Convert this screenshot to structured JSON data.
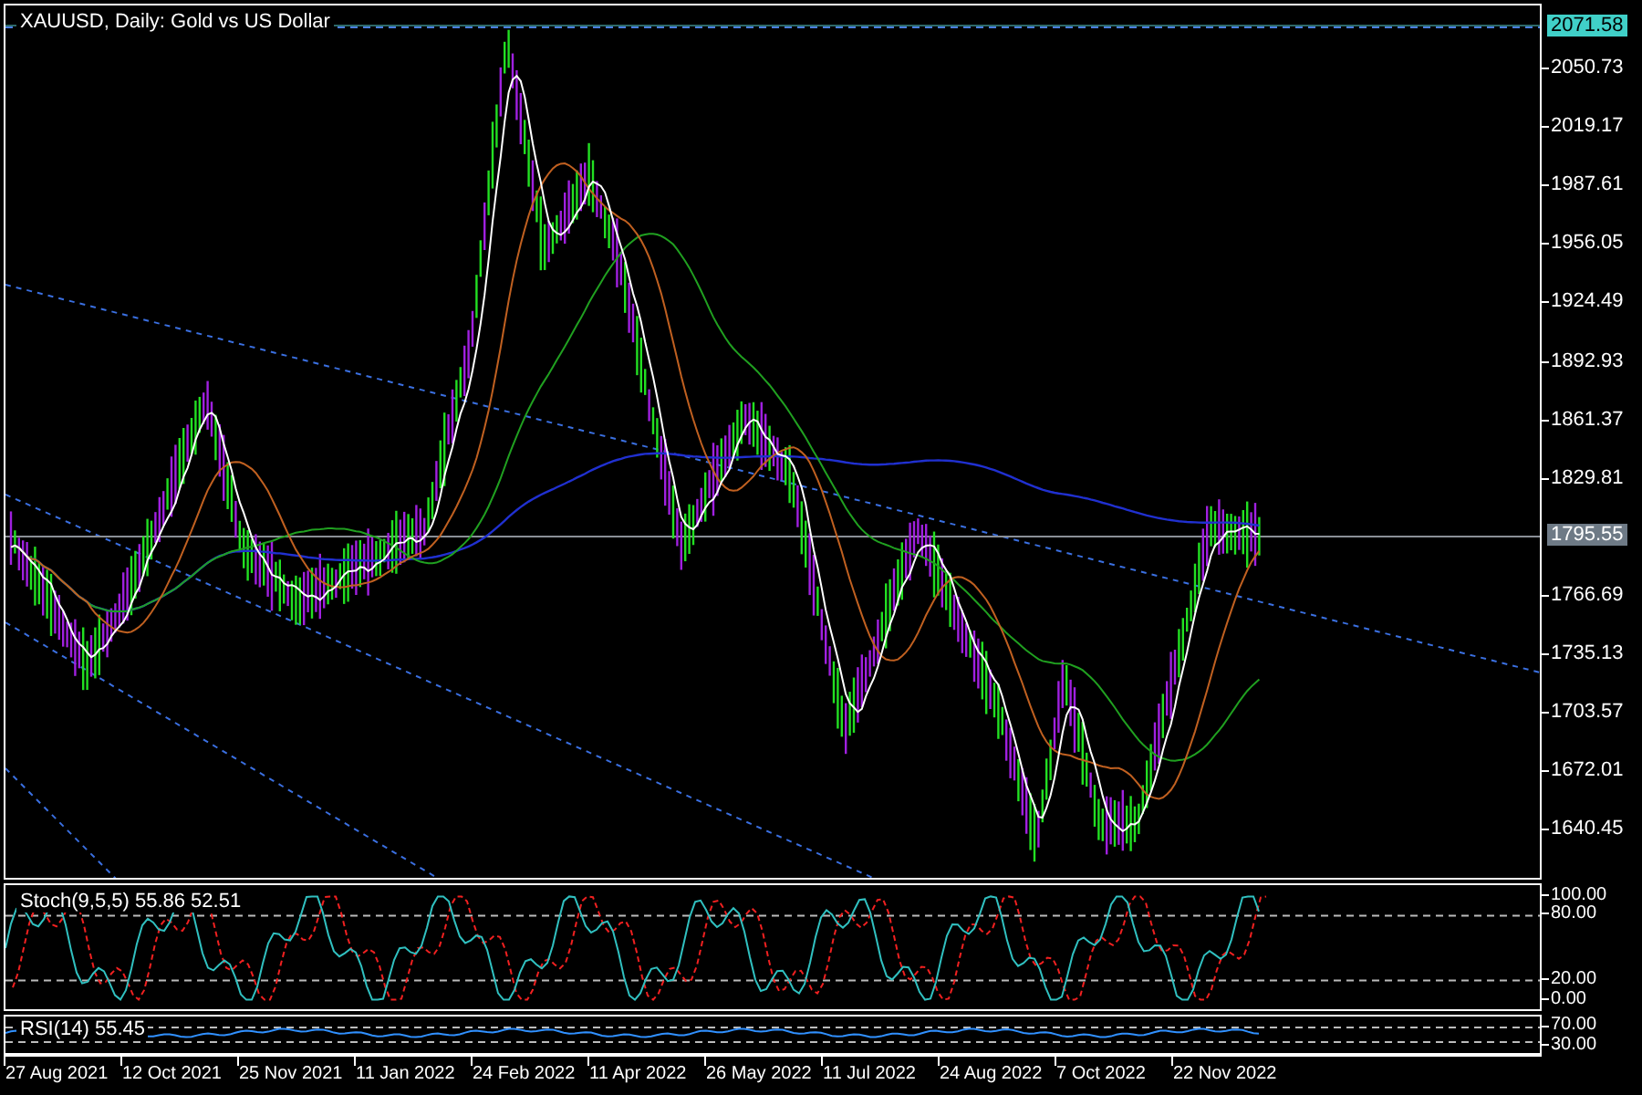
{
  "chart": {
    "title": "XAUUSD, Daily: Gold vs US Dollar",
    "high_marker": "2071.58",
    "last_price": "1795.55"
  },
  "price_axis": {
    "labels": [
      "2050.73",
      "2019.17",
      "1987.61",
      "1956.05",
      "1924.49",
      "1892.93",
      "1861.37",
      "1829.81",
      "1766.69",
      "1735.13",
      "1703.57",
      "1672.01",
      "1640.45"
    ]
  },
  "stochastic": {
    "label": "Stoch(9,5,5) 55.86 52.51",
    "axis_labels": [
      "100.00",
      "80.00",
      "20.00",
      "0.00"
    ]
  },
  "rsi": {
    "label": "RSI(14) 55.45",
    "axis_labels": [
      "70.00",
      "30.00"
    ]
  },
  "time_axis": {
    "labels": [
      "27 Aug 2021",
      "12 Oct 2021",
      "25 Nov 2021",
      "11 Jan 2022",
      "24 Feb 2022",
      "11 Apr 2022",
      "26 May 2022",
      "11 Jul 2022",
      "24 Aug 2022",
      "7 Oct 2022",
      "22 Nov 2022"
    ]
  }
}
